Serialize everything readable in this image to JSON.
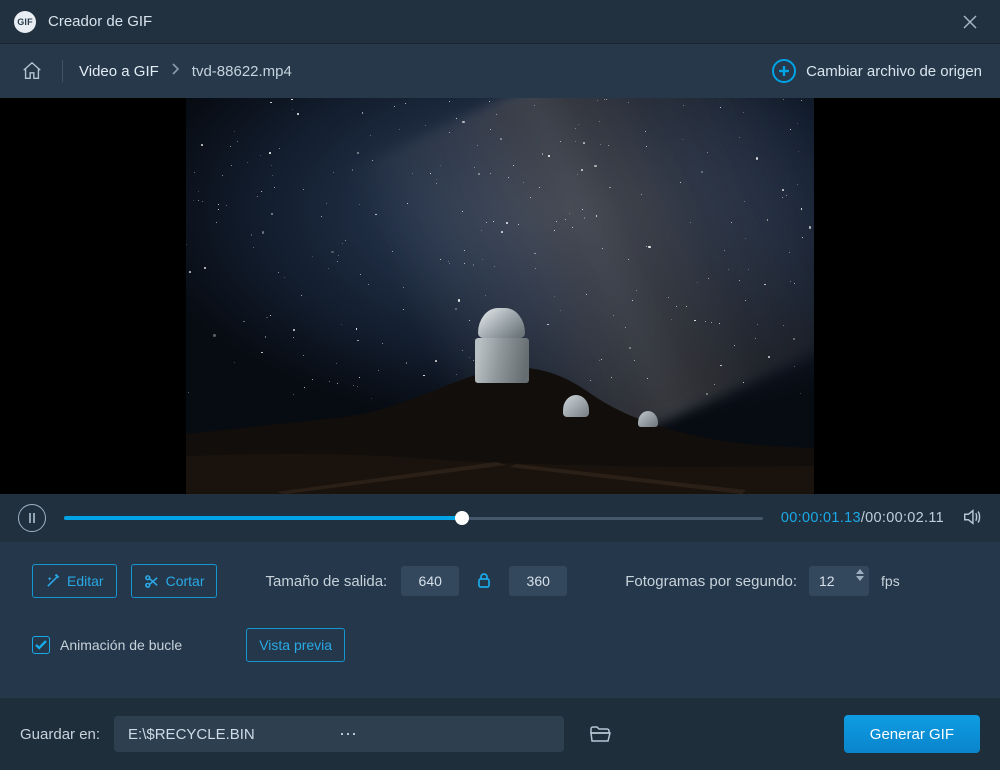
{
  "app": {
    "title": "Creador de GIF",
    "logo_text": "GIF"
  },
  "breadcrumb": {
    "mode": "Video a GIF",
    "file": "tvd-88622.mp4"
  },
  "actions": {
    "change_source": "Cambiar archivo de origen"
  },
  "playback": {
    "current_time": "00:00:01.13",
    "total_time": "00:00:02.11",
    "progress_pct": 57
  },
  "toolbar": {
    "edit": "Editar",
    "cut": "Cortar",
    "output_size_label": "Tamaño de salida:",
    "width": "640",
    "height": "360",
    "fps_label": "Fotogramas por segundo:",
    "fps": "12",
    "fps_unit": "fps",
    "loop_label": "Animación de bucle",
    "loop_checked": true,
    "preview": "Vista previa"
  },
  "output": {
    "save_in_label": "Guardar en:",
    "path": "E:\\$RECYCLE.BIN",
    "generate": "Generar GIF"
  }
}
